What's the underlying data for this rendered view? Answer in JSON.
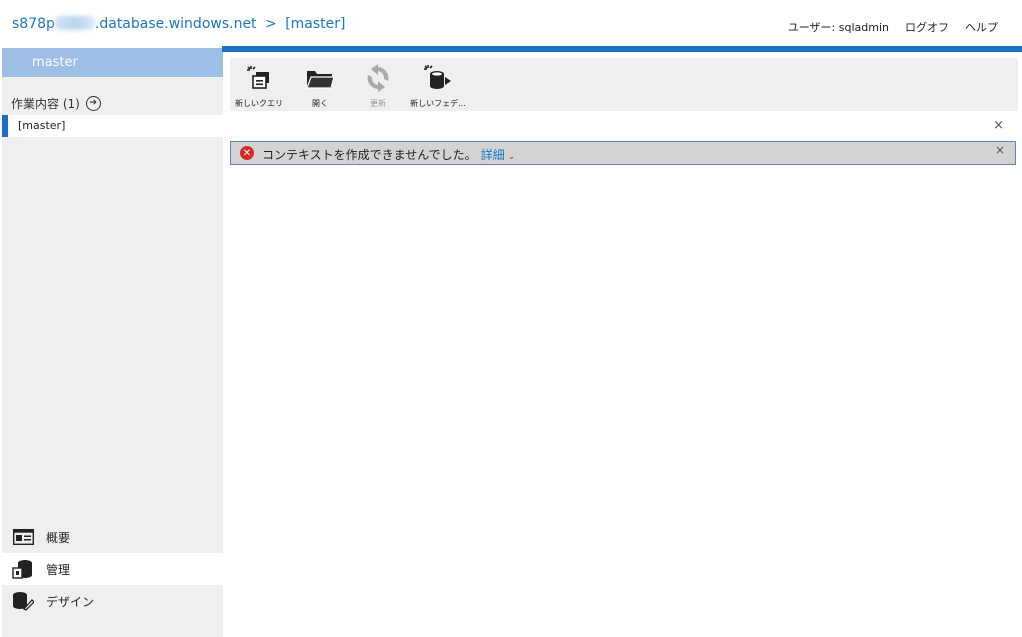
{
  "header": {
    "server_prefix": "s878p",
    "server_suffix": ".database.windows.net",
    "separator": ">",
    "database": "[master]",
    "user_label": "ユーザー: sqladmin",
    "logoff": "ログオフ",
    "help": "ヘルプ"
  },
  "sidebar": {
    "db_tab": "master",
    "work_title": "作業内容 (1)",
    "work_items": [
      {
        "label": "[master]"
      }
    ],
    "nav": [
      {
        "label": "概要",
        "icon": "overview-icon"
      },
      {
        "label": "管理",
        "icon": "database-manage-icon"
      },
      {
        "label": "デザイン",
        "icon": "design-icon"
      }
    ]
  },
  "toolbar": {
    "buttons": [
      {
        "label": "新しいクエリ",
        "icon": "new-query-icon",
        "enabled": true
      },
      {
        "label": "開く",
        "icon": "open-folder-icon",
        "enabled": true
      },
      {
        "label": "更新",
        "icon": "refresh-icon",
        "enabled": false
      },
      {
        "label": "新しいフェデ...",
        "icon": "new-federation-icon",
        "enabled": true
      }
    ]
  },
  "error": {
    "message": "コンテキストを作成できませんでした。",
    "details_label": "詳細",
    "close": "×"
  },
  "panel_close": "×",
  "colors": {
    "accent": "#1a6fc8",
    "link": "#1a78c2",
    "db_tab": "#9dbfe6",
    "error": "#d42a2a"
  }
}
